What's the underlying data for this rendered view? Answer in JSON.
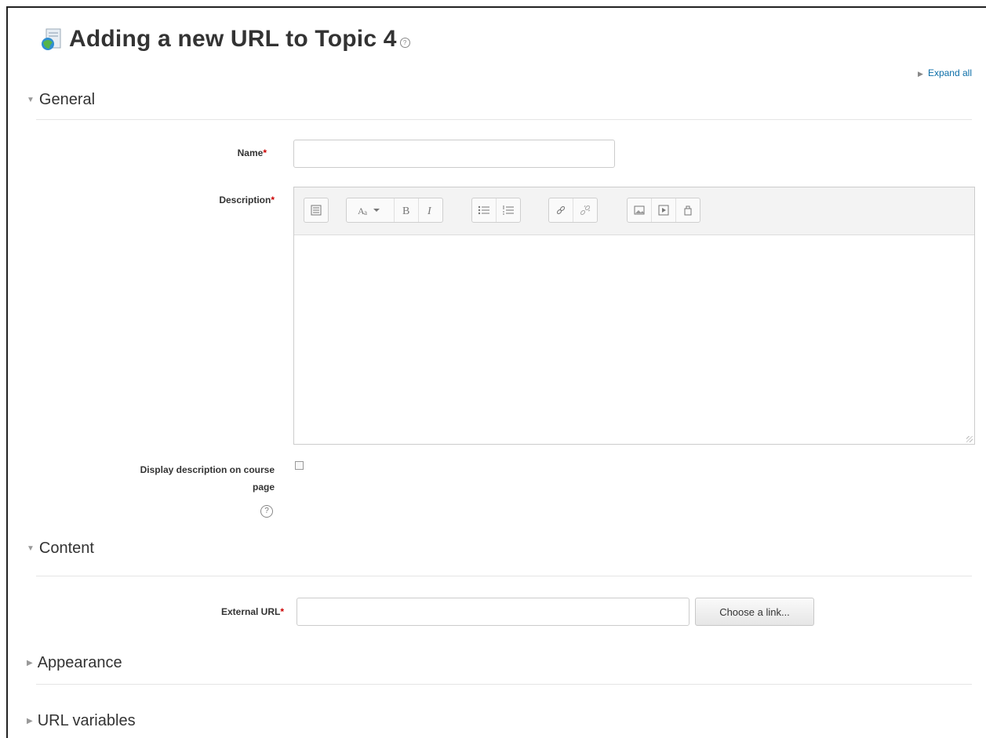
{
  "page": {
    "title": "Adding a new URL to Topic 4",
    "expand_all": "Expand all"
  },
  "sections": {
    "general": "General",
    "content": "Content",
    "appearance": "Appearance",
    "url_variables": "URL variables"
  },
  "fields": {
    "name_label": "Name",
    "name_value": "",
    "description_label": "Description",
    "display_description_label_line1": "Display description on course",
    "display_description_label_line2": "page",
    "external_url_label": "External URL",
    "external_url_value": "",
    "required_marker": "*"
  },
  "buttons": {
    "choose_link": "Choose a link..."
  },
  "toolbar": {
    "groups": [
      [
        "collapse-icon"
      ],
      [
        "font-style-icon",
        "bold-icon",
        "italic-icon"
      ],
      [
        "unordered-list-icon",
        "ordered-list-icon"
      ],
      [
        "link-icon",
        "unlink-icon"
      ],
      [
        "image-icon",
        "media-icon",
        "manage-files-icon"
      ]
    ]
  },
  "colors": {
    "link": "#0d6fa8",
    "required": "#cc0000"
  }
}
